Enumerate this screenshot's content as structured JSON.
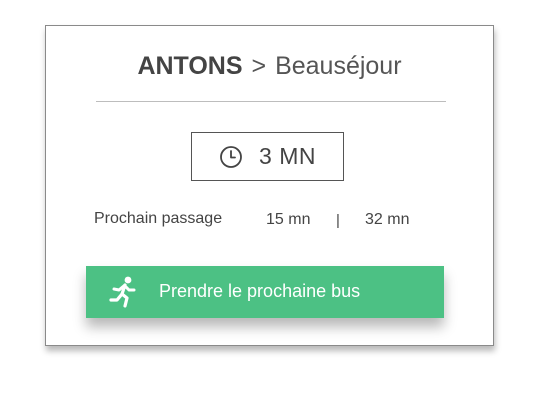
{
  "route": {
    "origin": "ANTONS",
    "separator": ">",
    "destination": "Beauséjour"
  },
  "wait": {
    "icon": "clock-icon",
    "value": "3 MN"
  },
  "next_passage": {
    "label": "Prochain passage",
    "times": [
      "15 mn",
      "32 mn"
    ],
    "separator": "|"
  },
  "cta": {
    "icon": "running-person-icon",
    "label": "Prendre le prochaine bus",
    "color": "#4cc184"
  }
}
